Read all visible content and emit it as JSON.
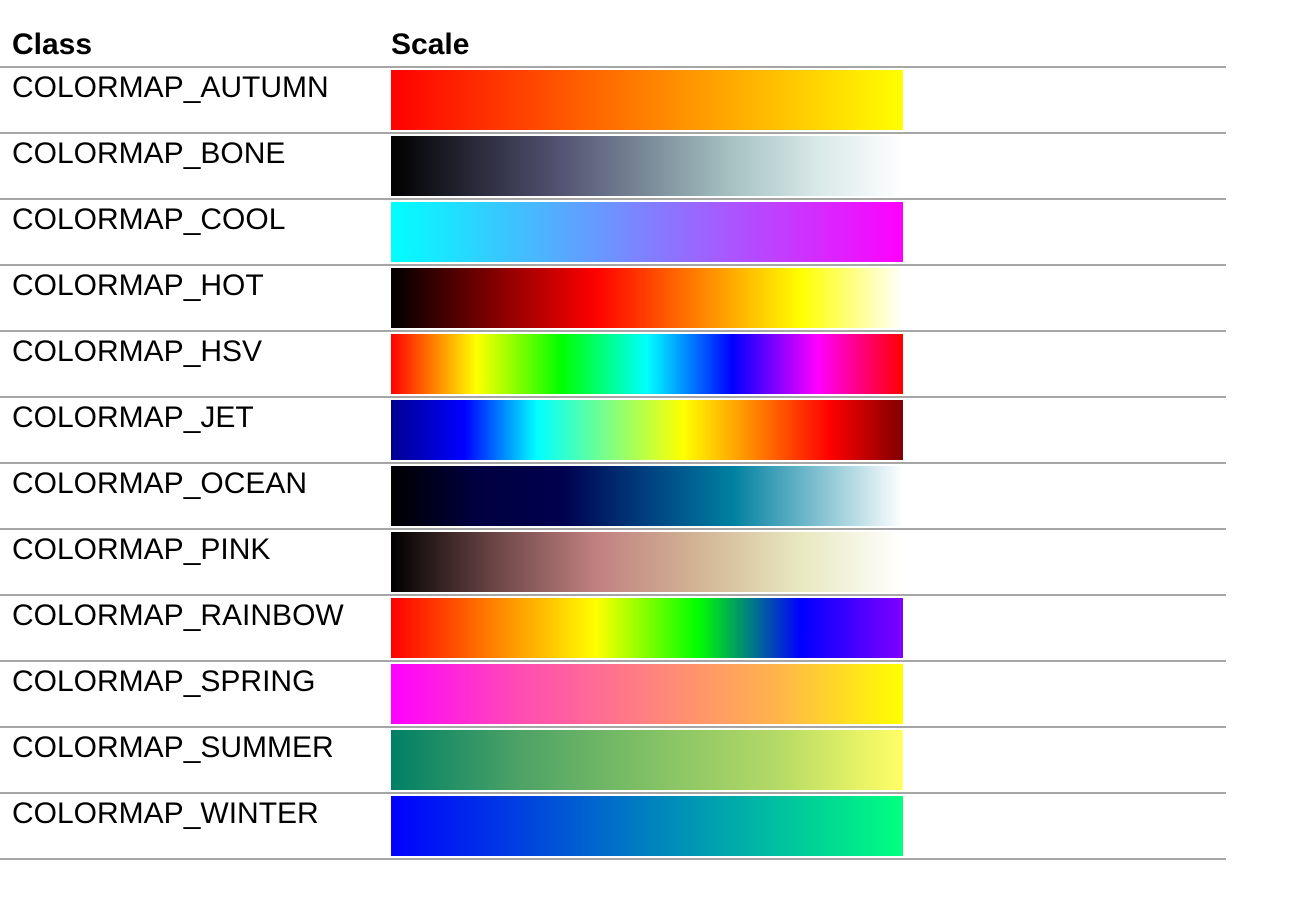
{
  "header": {
    "class_label": "Class",
    "scale_label": "Scale"
  },
  "rows": [
    {
      "name": "COLORMAP_AUTUMN",
      "colors": [
        "#ff0000",
        "#ff4000",
        "#ff8000",
        "#ffc000",
        "#ffff00"
      ]
    },
    {
      "name": "COLORMAP_BONE",
      "colors": [
        "#000000",
        "#2a2a3a",
        "#545474",
        "#7a8a98",
        "#a6c2c2",
        "#d9e8e8",
        "#ffffff"
      ]
    },
    {
      "name": "COLORMAP_COOL",
      "colors": [
        "#00ffff",
        "#40bfff",
        "#8080ff",
        "#bf40ff",
        "#ff00ff"
      ]
    },
    {
      "name": "COLORMAP_HOT",
      "colors": [
        "#000000",
        "#800000",
        "#ff0000",
        "#ff8000",
        "#ffff00",
        "#ffffff"
      ]
    },
    {
      "name": "COLORMAP_HSV",
      "colors": [
        "#ff0000",
        "#ffff00",
        "#00ff00",
        "#00ffff",
        "#0000ff",
        "#ff00ff",
        "#ff0000"
      ]
    },
    {
      "name": "COLORMAP_JET",
      "colors": [
        "#00008f",
        "#0000ff",
        "#00ffff",
        "#80ff80",
        "#ffff00",
        "#ff8000",
        "#ff0000",
        "#800000"
      ]
    },
    {
      "name": "COLORMAP_OCEAN",
      "colors": [
        "#000000",
        "#000040",
        "#00004d",
        "#004080",
        "#0080a0",
        "#80c0d0",
        "#ffffff"
      ]
    },
    {
      "name": "COLORMAP_PINK",
      "colors": [
        "#000000",
        "#6b4545",
        "#c08080",
        "#d2b494",
        "#e8e8c0",
        "#ffffff"
      ]
    },
    {
      "name": "COLORMAP_RAINBOW",
      "colors": [
        "#ff0000",
        "#ff8000",
        "#ffff00",
        "#00ff00",
        "#0000ff",
        "#8000ff"
      ]
    },
    {
      "name": "COLORMAP_SPRING",
      "colors": [
        "#ff00ff",
        "#ff4cb3",
        "#ff8080",
        "#ffb34c",
        "#ffff00"
      ]
    },
    {
      "name": "COLORMAP_SUMMER",
      "colors": [
        "#008066",
        "#4da266",
        "#80c066",
        "#b3d966",
        "#ffff66"
      ]
    },
    {
      "name": "COLORMAP_WINTER",
      "colors": [
        "#0000ff",
        "#0040e0",
        "#0080c0",
        "#00bfa0",
        "#00ff80"
      ]
    }
  ]
}
